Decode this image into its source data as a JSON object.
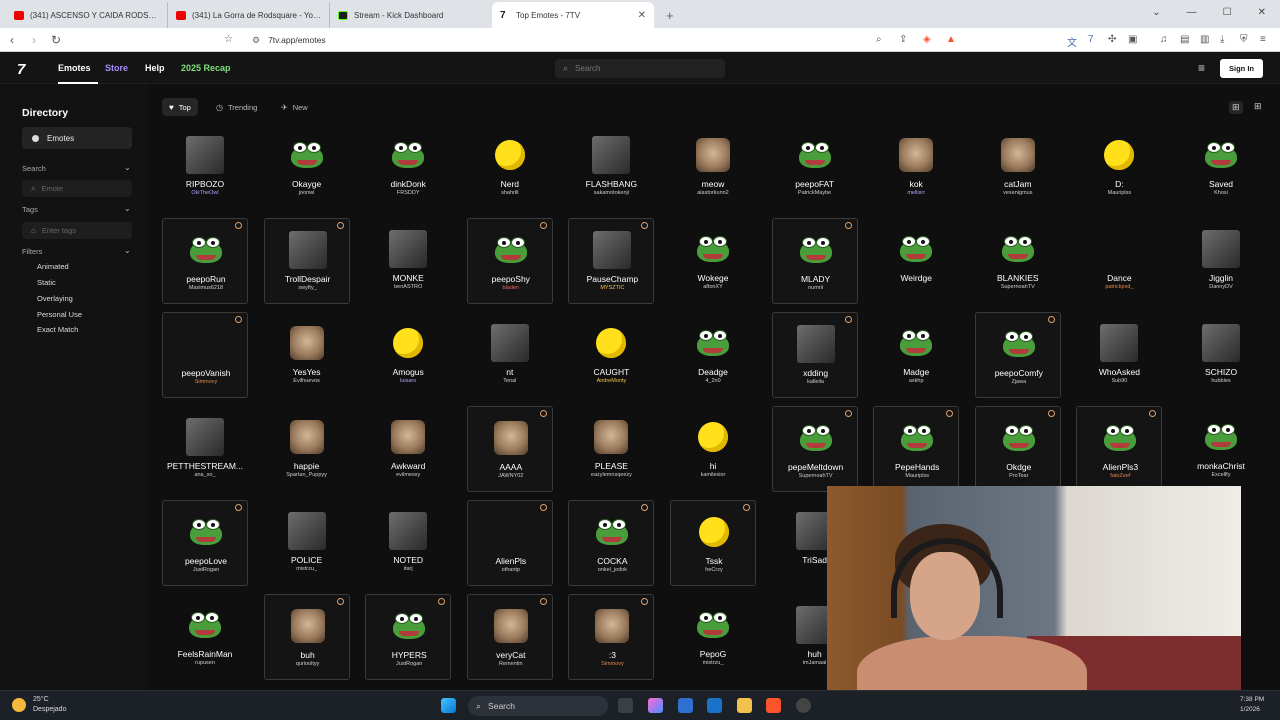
{
  "browser": {
    "tabs": [
      {
        "icon": "youtube-icon",
        "title": "(341) ASCENSO Y CAIDA RODSQUAR",
        "active": false
      },
      {
        "icon": "youtube-icon",
        "title": "(341) La Gorra de Rodsquare - YouTu",
        "active": false
      },
      {
        "icon": "kick-icon",
        "title": "Stream - Kick Dashboard",
        "active": false
      },
      {
        "icon": "7tv-icon",
        "title": "Top Emotes - 7TV",
        "active": true
      }
    ],
    "url": "7tv.app/emotes"
  },
  "site": {
    "logo": "7tv-logo",
    "nav": {
      "emotes": "Emotes",
      "store": "Store",
      "help": "Help",
      "recap": "2025 Recap"
    },
    "search_placeholder": "Search",
    "sign_in": "Sign In"
  },
  "sidebar": {
    "title": "Directory",
    "emotes_item": "Emotes",
    "search_label": "Search",
    "search_placeholder": "Emote",
    "tags_label": "Tags",
    "tags_placeholder": "Enter tags",
    "filters_label": "Filters",
    "filters": [
      "Animated",
      "Static",
      "Overlaying",
      "Personal Use",
      "Exact Match"
    ]
  },
  "tabs": {
    "top": "Top",
    "trending": "Trending",
    "new": "New"
  },
  "emotes": [
    [
      {
        "name": "RIPBOZO",
        "author": "OkiTheOwl",
        "author_color": "#b9a0ff",
        "boxed": false,
        "art": "photo"
      },
      {
        "name": "Okayge",
        "author": "joonwi",
        "boxed": false,
        "art": "frog"
      },
      {
        "name": "dinkDonk",
        "author": "FRSDDY",
        "boxed": false,
        "art": "frog"
      },
      {
        "name": "Nerd",
        "author": "shahrill",
        "boxed": false,
        "art": "yellow"
      },
      {
        "name": "FLASHBANG",
        "author": "sakamotokenji",
        "boxed": false,
        "art": "photo"
      },
      {
        "name": "meow",
        "author": "alastorkunn2",
        "boxed": false,
        "art": "cat"
      },
      {
        "name": "peepoFAT",
        "author": "PatrickMaybe",
        "boxed": false,
        "art": "frog"
      },
      {
        "name": "kok",
        "author": "mellsirr",
        "author_color": "#b9a0ff",
        "boxed": false,
        "art": "cat"
      },
      {
        "name": "catJam",
        "author": "vexenigmus",
        "boxed": false,
        "art": "cat"
      },
      {
        "name": "D:",
        "author": "Mauriplss",
        "boxed": false,
        "art": "yellow"
      },
      {
        "name": "Saved",
        "author": "Khosi",
        "boxed": false,
        "art": "frog"
      }
    ],
    [
      {
        "name": "peepoRun",
        "author": "Maximus6218",
        "boxed": true,
        "art": "frog"
      },
      {
        "name": "TrollDespair",
        "author": "swyfty_",
        "boxed": true,
        "art": "photo"
      },
      {
        "name": "MONKE",
        "author": "benASTRO",
        "boxed": false,
        "art": "photo"
      },
      {
        "name": "peepoShy",
        "author": "bladen",
        "author_color": "#e26a6a",
        "boxed": true,
        "art": "frog"
      },
      {
        "name": "PauseChamp",
        "author": "MYSZTIC",
        "author_color": "#f5c542",
        "boxed": true,
        "art": "photo"
      },
      {
        "name": "Wokege",
        "author": "aftonXY",
        "boxed": false,
        "art": "frog"
      },
      {
        "name": "MLADY",
        "author": "numrii",
        "boxed": true,
        "art": "frog"
      },
      {
        "name": "Weirdge",
        "author": "",
        "boxed": false,
        "art": "frog"
      },
      {
        "name": "BLANKIES",
        "author": "SupernoahTV",
        "boxed": false,
        "art": "frog"
      },
      {
        "name": "Dance",
        "author": "patrickpxd_",
        "author_color": "#e0884a",
        "boxed": false,
        "art": "none"
      },
      {
        "name": "Jigglin",
        "author": "DannyDV",
        "boxed": false,
        "art": "photo"
      }
    ],
    [
      {
        "name": "peepoVanish",
        "author": "Simmovy",
        "author_color": "#e0884a",
        "boxed": true,
        "art": "none"
      },
      {
        "name": "YesYes",
        "author": "Evilhuevos",
        "boxed": false,
        "art": "cat"
      },
      {
        "name": "Amogus",
        "author": "luisaro",
        "author_color": "#b9a0ff",
        "boxed": false,
        "art": "yellow"
      },
      {
        "name": "nt",
        "author": "Tenal",
        "boxed": false,
        "art": "photo"
      },
      {
        "name": "CAUGHT",
        "author": "AndreMonty",
        "author_color": "#f5c542",
        "boxed": false,
        "art": "yellow"
      },
      {
        "name": "Deadge",
        "author": "4_2n0",
        "boxed": false,
        "art": "frog"
      },
      {
        "name": "xdding",
        "author": "kalleila",
        "boxed": true,
        "art": "photo"
      },
      {
        "name": "Madge",
        "author": "askhp",
        "boxed": false,
        "art": "frog"
      },
      {
        "name": "peepoComfy",
        "author": "Zjawa",
        "boxed": true,
        "art": "frog"
      },
      {
        "name": "WhoAsked",
        "author": "Sub90",
        "boxed": false,
        "art": "photo"
      },
      {
        "name": "SCHIZO",
        "author": "hubbles",
        "boxed": false,
        "art": "photo"
      }
    ],
    [
      {
        "name": "PETTHESTREAM...",
        "author": "ana_so_",
        "boxed": false,
        "art": "photo"
      },
      {
        "name": "happie",
        "author": "Spartan_Puppyy",
        "boxed": false,
        "art": "cat"
      },
      {
        "name": "Awkward",
        "author": "evilmessy",
        "boxed": false,
        "art": "cat"
      },
      {
        "name": "AAAA",
        "author": "JAWNY02",
        "boxed": true,
        "art": "cat"
      },
      {
        "name": "PLEASE",
        "author": "eazylemnsqeezy",
        "boxed": false,
        "art": "cat"
      },
      {
        "name": "hi",
        "author": "kamilexior",
        "boxed": false,
        "art": "yellow"
      },
      {
        "name": "pepeMeltdown",
        "author": "SupernoahTV",
        "boxed": true,
        "art": "frog"
      },
      {
        "name": "PepeHands",
        "author": "Mauriplss",
        "boxed": true,
        "art": "frog"
      },
      {
        "name": "Okdge",
        "author": "ProTear",
        "boxed": true,
        "art": "frog"
      },
      {
        "name": "AlienPls3",
        "author": "fatoZeef",
        "author_color": "#e0884a",
        "boxed": true,
        "art": "frog"
      },
      {
        "name": "monkaChrist",
        "author": "Excellfy",
        "boxed": false,
        "art": "frog"
      }
    ],
    [
      {
        "name": "peepoLove",
        "author": "JustRogan",
        "boxed": true,
        "art": "frog"
      },
      {
        "name": "POLICE",
        "author": "mistrzu_",
        "boxed": false,
        "art": "photo"
      },
      {
        "name": "NOTED",
        "author": "itarj",
        "boxed": false,
        "art": "photo"
      },
      {
        "name": "AlienPls",
        "author": "othantp",
        "boxed": true,
        "art": "none"
      },
      {
        "name": "COCKA",
        "author": "onkel_jodok",
        "boxed": true,
        "art": "frog"
      },
      {
        "name": "Tssk",
        "author": "heCrzy",
        "boxed": true,
        "art": "yellow"
      },
      {
        "name": "TriSad",
        "author": "",
        "boxed": false,
        "art": "photo"
      }
    ],
    [
      {
        "name": "FeelsRainMan",
        "author": "rupusen",
        "boxed": false,
        "art": "frog"
      },
      {
        "name": "buh",
        "author": "quriooltyy",
        "boxed": true,
        "art": "cat"
      },
      {
        "name": "HYPERS",
        "author": "JustRogan",
        "boxed": true,
        "art": "frog"
      },
      {
        "name": "veryCat",
        "author": "Rementin",
        "boxed": true,
        "art": "cat"
      },
      {
        "name": ":3",
        "author": "Simmovy",
        "author_color": "#e0884a",
        "boxed": true,
        "art": "cat"
      },
      {
        "name": "PepoG",
        "author": "mistrzu_",
        "boxed": false,
        "art": "frog"
      },
      {
        "name": "huh",
        "author": "imJamaal",
        "boxed": false,
        "art": "photo"
      }
    ]
  ],
  "taskbar": {
    "temp": "25°C",
    "weather": "Despejado",
    "search": "Search",
    "time": "7:38 PM",
    "date": "1/2026"
  }
}
